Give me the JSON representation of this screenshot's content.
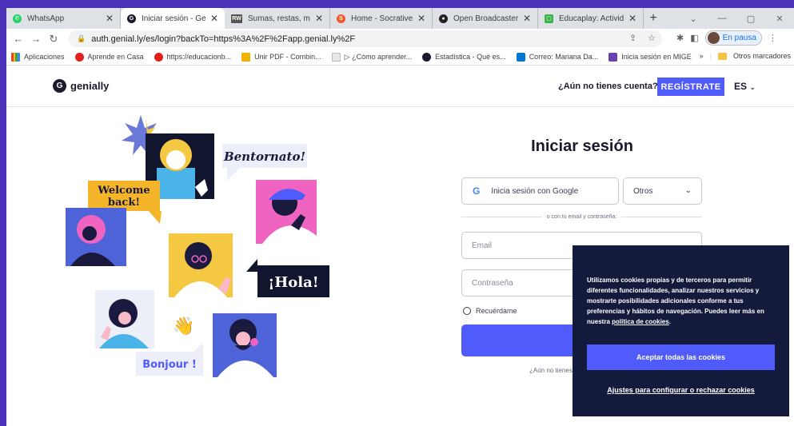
{
  "browser": {
    "tabs": [
      {
        "label": "WhatsApp",
        "color": "#25d366",
        "active": false
      },
      {
        "label": "Iniciar sesión - Geniall",
        "color": "#1a1a2e",
        "active": true
      },
      {
        "label": "Sumas, restas, multipli",
        "color": "#555555",
        "active": false
      },
      {
        "label": "Home - Socrative",
        "color": "#f15a24",
        "active": false
      },
      {
        "label": "Open Broadcaster Sof",
        "color": "#222222",
        "active": false
      },
      {
        "label": "Educaplay: Actividade",
        "color": "#3bb34a",
        "active": false
      }
    ],
    "url": "auth.genial.ly/es/login?backTo=https%3A%2F%2Fapp.genial.ly%2F",
    "profile_status": "En pausa",
    "bookmarks": [
      {
        "label": "Aplicaciones",
        "color": "#4285f4"
      },
      {
        "label": "Aprende en Casa",
        "color": "#e0211b"
      },
      {
        "label": "https://educacionb...",
        "color": "#e0211b"
      },
      {
        "label": "Unir PDF - Combin...",
        "color": "#f0b400"
      },
      {
        "label": "▷ ¿Cómo aprender...",
        "color": "#bbbbbb"
      },
      {
        "label": "Estadística - Qué es...",
        "color": "#1a1a2e"
      },
      {
        "label": "Correo: Mariana Da...",
        "color": "#0078d4"
      },
      {
        "label": "Inicia sesión en MIGE",
        "color": "#6a3fb0"
      }
    ],
    "other_bookmarks": "Otros marcadores"
  },
  "header": {
    "brand": "genially",
    "no_account": "¿Aún no tienes cuenta?",
    "register": "REGÍSTRATE",
    "language": "ES"
  },
  "illustration": {
    "bentornato": "Bentornato!",
    "welcome": "Welcome back!",
    "hola": "¡Hola!",
    "bonjour": "Bonjour !"
  },
  "login": {
    "title": "Iniciar sesión",
    "google": "Inicia sesión con Google",
    "others": "Otros",
    "divider": "o con tu email y contraseña:",
    "email_placeholder": "Email",
    "password_placeholder": "Contraseña",
    "remember": "Recuérdame",
    "submit_partial": "E",
    "no_account_partial": "¿Aún no tienes"
  },
  "cookies": {
    "text_before": "Utilizamos cookies propias y de terceros para permitir diferentes funcionalidades, analizar nuestros servicios y mostrarte posibilidades adicionales conforme a tus preferencias y hábitos de navegación. Puedes leer más en nuestra ",
    "policy_link": "política de cookies",
    "text_after": ".",
    "accept": "Aceptar todas las cookies",
    "settings": "Ajustes para configurar o rechazar cookies"
  }
}
